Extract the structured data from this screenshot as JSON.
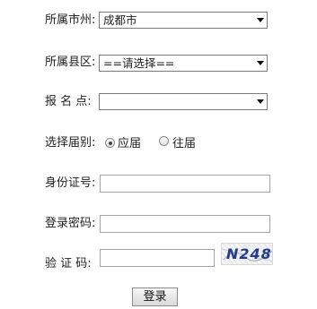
{
  "form": {
    "city": {
      "label": "所属市州:",
      "value": "成都市"
    },
    "county": {
      "label": "所属县区:",
      "value": "==请选择=="
    },
    "site": {
      "label": "报 名 点:",
      "value": ""
    },
    "session": {
      "label": "选择届别:",
      "options": [
        {
          "label": "应届",
          "selected": true
        },
        {
          "label": "往届",
          "selected": false
        }
      ]
    },
    "id_number": {
      "label": "身份证号:",
      "value": ""
    },
    "password": {
      "label": "登录密码:",
      "value": ""
    },
    "captcha": {
      "label": "验 证 码:",
      "value": "",
      "image_text": "N248"
    },
    "submit_label": "登录"
  },
  "icons": {
    "dropdown": "chevron-down-icon"
  }
}
